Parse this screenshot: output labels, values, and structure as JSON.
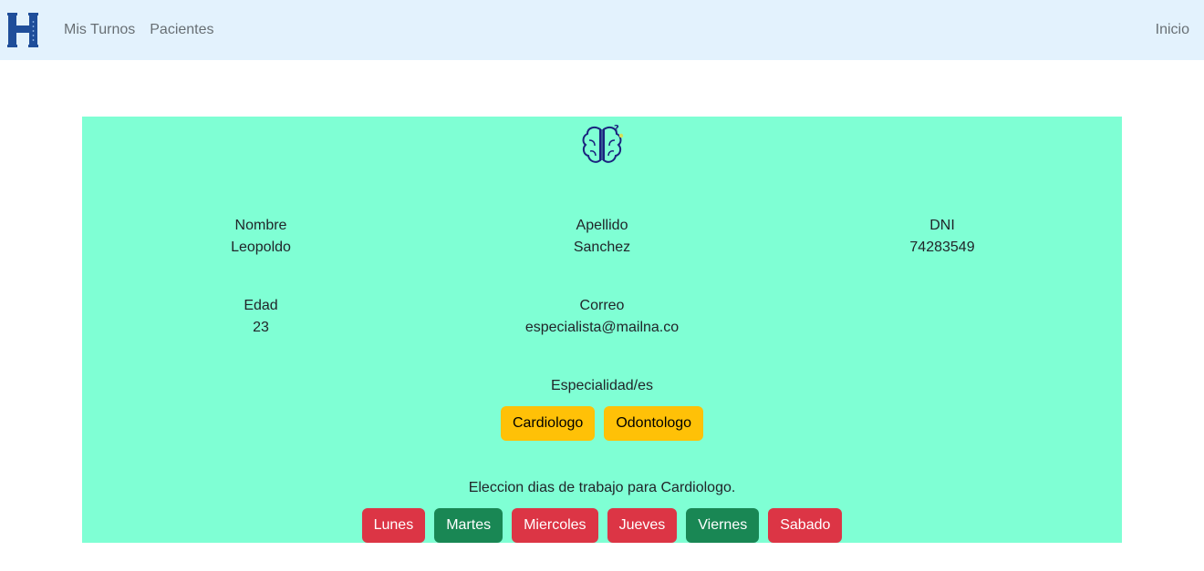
{
  "navbar": {
    "logo_icon": "hospital-h-logo",
    "links": [
      {
        "label": "Mis Turnos"
      },
      {
        "label": "Pacientes"
      }
    ],
    "right_link": "Inicio"
  },
  "profile": {
    "avatar_icon": "brain-question-icon",
    "fields": {
      "nombre": {
        "label": "Nombre",
        "value": "Leopoldo"
      },
      "apellido": {
        "label": "Apellido",
        "value": "Sanchez"
      },
      "dni": {
        "label": "DNI",
        "value": "74283549"
      },
      "edad": {
        "label": "Edad",
        "value": "23"
      },
      "correo": {
        "label": "Correo",
        "value": "especialista@mailna.co"
      }
    },
    "especialidades_title": "Especialidad/es",
    "especialidades": [
      {
        "label": "Cardiologo"
      },
      {
        "label": "Odontologo"
      }
    ],
    "dias_title": "Eleccion dias de trabajo para Cardiologo.",
    "dias": [
      {
        "label": "Lunes",
        "selected": false
      },
      {
        "label": "Martes",
        "selected": true
      },
      {
        "label": "Miercoles",
        "selected": false
      },
      {
        "label": "Jueves",
        "selected": false
      },
      {
        "label": "Viernes",
        "selected": true
      },
      {
        "label": "Sabado",
        "selected": false
      }
    ]
  },
  "colors": {
    "navbar_bg": "#e3f2fd",
    "card_bg": "#7fffd4",
    "warning": "#ffc107",
    "danger": "#dc3545",
    "success": "#198754"
  }
}
